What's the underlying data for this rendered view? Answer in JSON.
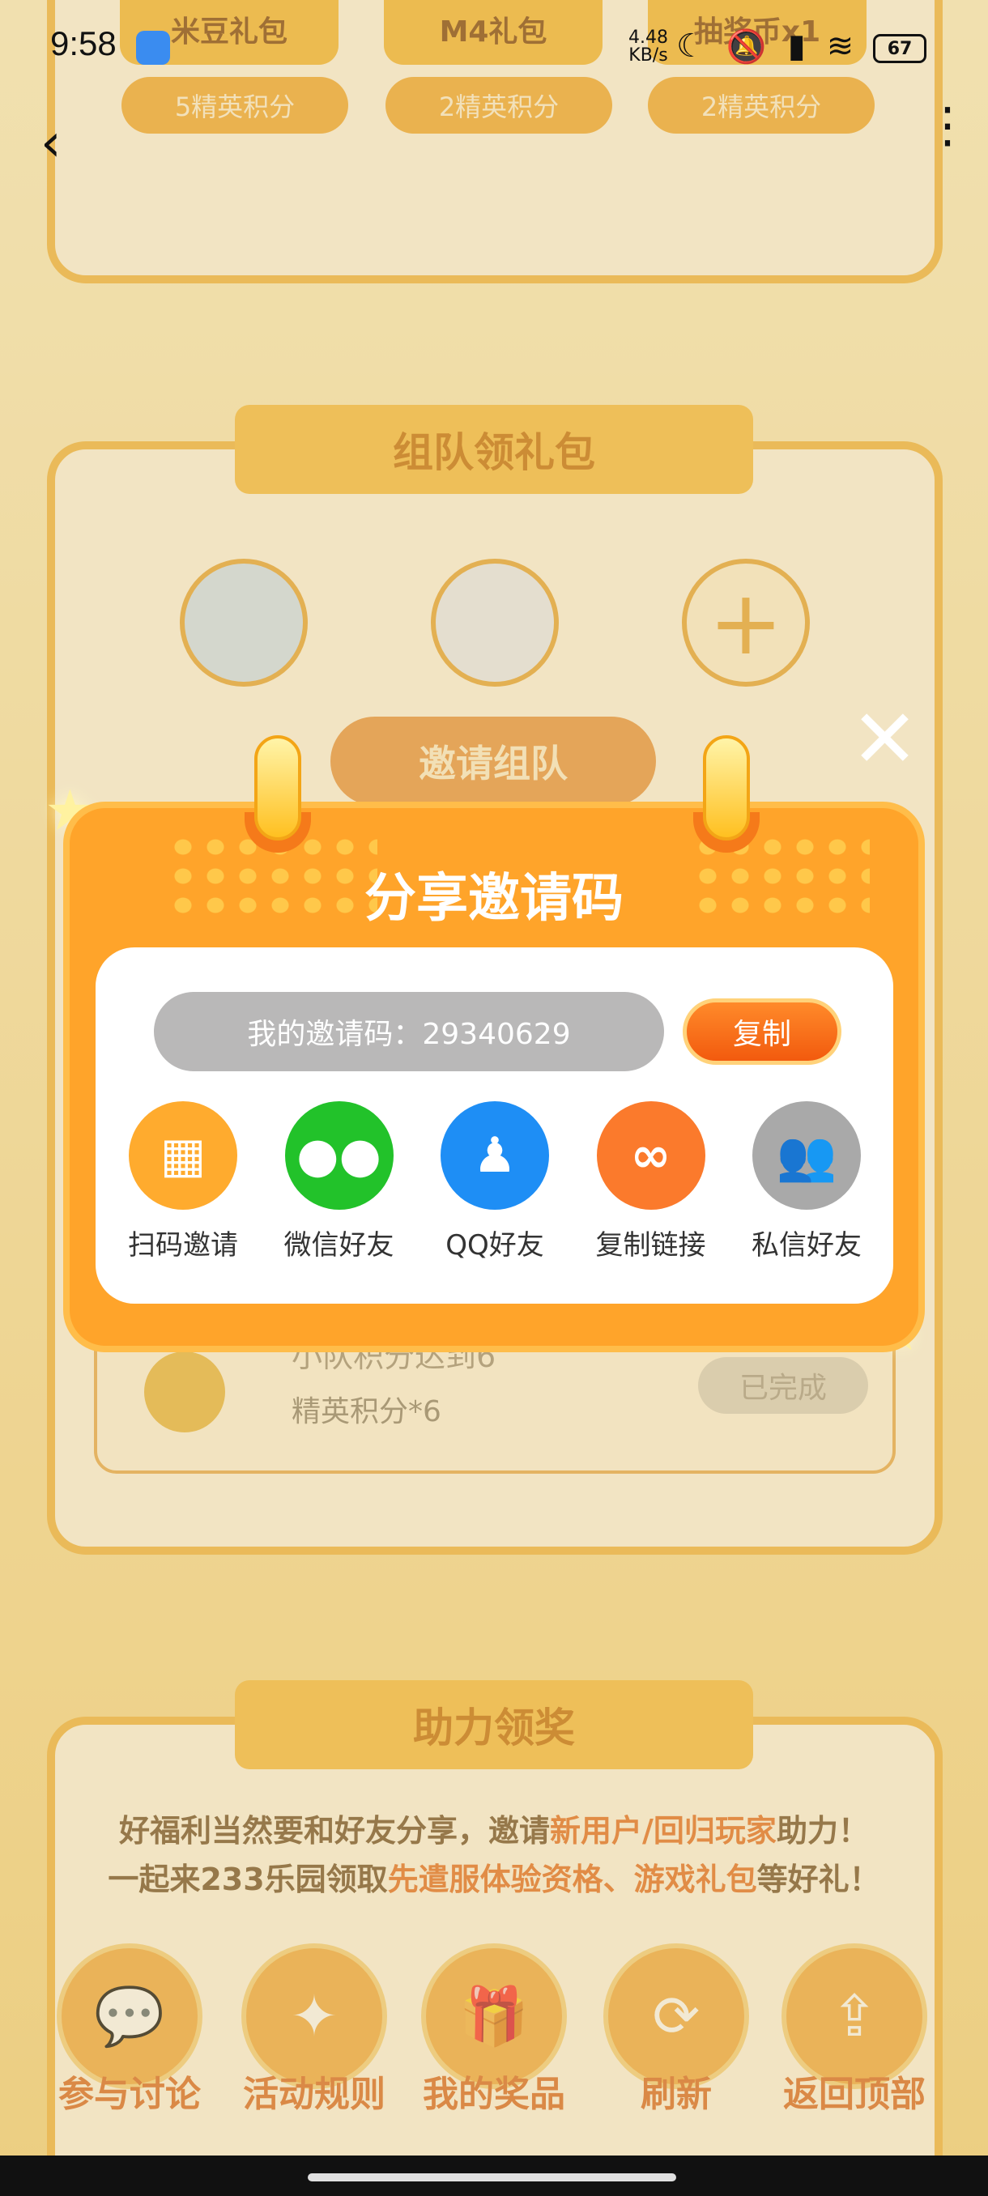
{
  "status_bar": {
    "time": "9:58",
    "net_speed_value": "4.48",
    "net_speed_unit": "KB/s",
    "battery": "67"
  },
  "background": {
    "gifts": [
      {
        "name": "米豆礼包",
        "points": "5精英积分"
      },
      {
        "name": "M4礼包",
        "points": "2精英积分"
      },
      {
        "name": "抽奖币x1",
        "points": "2精英积分"
      }
    ],
    "team_title": "组队领礼包",
    "invite_team_button": "邀请组队",
    "task": {
      "title": "小队积分达到6",
      "reward": "精英积分*6",
      "status": "已完成"
    },
    "help_title": "助力领奖",
    "help_line1_a": "好福利当然要和好友分享，邀请",
    "help_line1_hl": "新用户/回归玩家",
    "help_line1_b": "助力！",
    "help_line2_a": "一起来233乐园领取",
    "help_line2_hl": "先遣服体验资格、游戏礼包",
    "help_line2_b": "等好礼！"
  },
  "bottom_nav": [
    {
      "label": "参与讨论",
      "icon": "chat-icon"
    },
    {
      "label": "活动规则",
      "icon": "rules-icon"
    },
    {
      "label": "我的奖品",
      "icon": "gift-icon"
    },
    {
      "label": "刷新",
      "icon": "refresh-icon"
    },
    {
      "label": "返回顶部",
      "icon": "upload-icon"
    }
  ],
  "modal": {
    "title": "分享邀请码",
    "invite_code_text": "我的邀请码：29340629",
    "copy_label": "复制",
    "share_options": [
      {
        "label": "扫码邀请",
        "icon": "qr-code-icon",
        "color": "#ffab2e"
      },
      {
        "label": "微信好友",
        "icon": "wechat-icon",
        "color": "#22c22a"
      },
      {
        "label": "QQ好友",
        "icon": "qq-icon",
        "color": "#1e8ef5"
      },
      {
        "label": "复制链接",
        "icon": "link-icon",
        "color": "#fb7a2c"
      },
      {
        "label": "私信好友",
        "icon": "users-icon",
        "color": "#a9a9a9"
      }
    ]
  }
}
